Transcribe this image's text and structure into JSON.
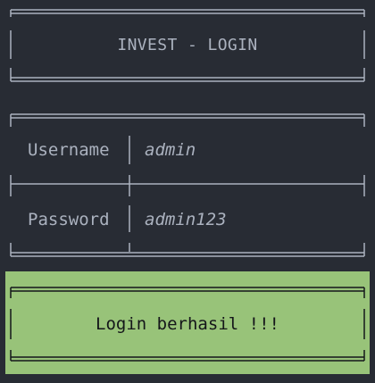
{
  "header": {
    "title": "INVEST - LOGIN"
  },
  "form": {
    "username_label": "Username",
    "username_value": "admin",
    "password_label": "Password",
    "password_value": "admin123"
  },
  "alert": {
    "message": "Login berhasil !!!",
    "color": "#98c379"
  },
  "theme": {
    "background": "#282c34",
    "text": "#abb2bf",
    "border": "#abb2bf"
  }
}
